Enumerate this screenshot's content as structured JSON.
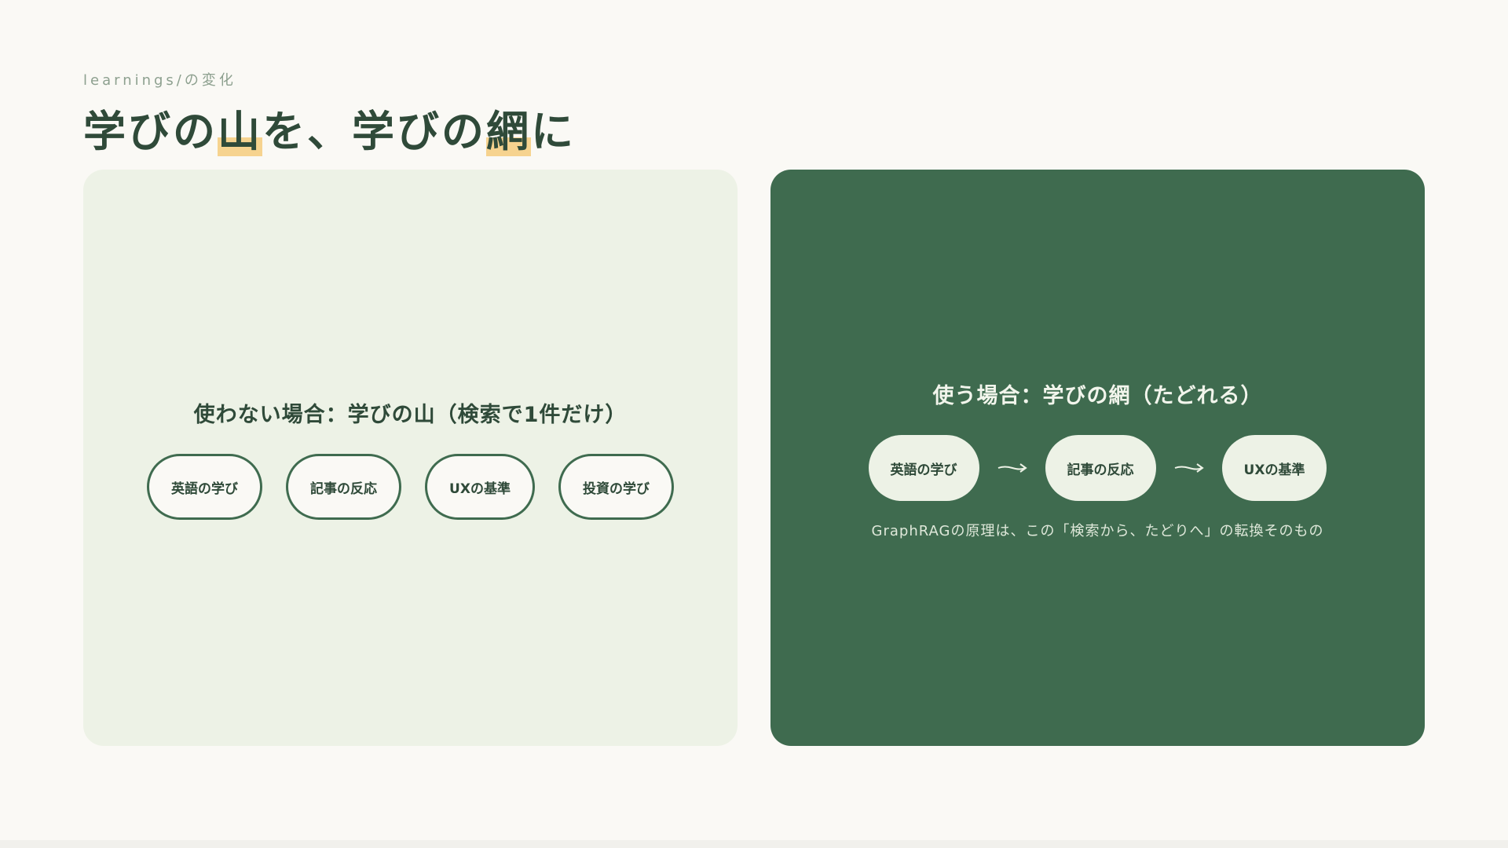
{
  "header": {
    "eyebrow": "learnings/の変化",
    "title_parts": [
      "学びの",
      "山",
      "を、学びの",
      "網",
      "に"
    ]
  },
  "left_panel": {
    "heading": "使わない場合：学びの山（検索で1件だけ）",
    "pills": [
      "英語の学び",
      "記事の反応",
      "UXの基準",
      "投資の学び"
    ]
  },
  "right_panel": {
    "heading": "使う場合：学びの網（たどれる）",
    "pills": [
      "英語の学び",
      "記事の反応",
      "UXの基準"
    ],
    "caption": "GraphRAGの原理は、この「検索から、たどりへ」の転換そのもの"
  },
  "colors": {
    "background": "#faf9f5",
    "primary_green": "#3f6b4f",
    "light_green": "#edf2e6",
    "highlight": "#f6d38f",
    "text_dark": "#2f4a39"
  },
  "icons": {
    "arrow": "arrow-right-icon"
  }
}
